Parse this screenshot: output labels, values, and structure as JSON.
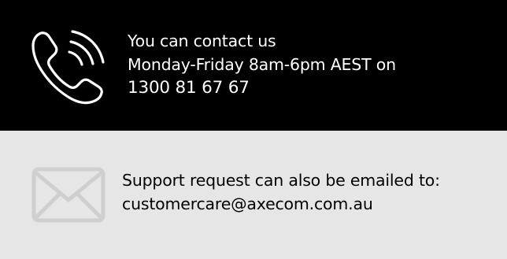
{
  "phone_section": {
    "icon": "phone-call-icon",
    "line1": "You can contact us",
    "line2": "Monday-Friday 8am-6pm AEST on",
    "phone_number": "1300 81 67 67",
    "background": "#000000",
    "text_color": "#ffffff"
  },
  "email_section": {
    "icon": "envelope-icon",
    "line1": "Support request can also be emailed to:",
    "email": "customercare@axecom.com.au",
    "background": "#e6e6e6",
    "text_color": "#000000",
    "icon_color": "#cfcfcf"
  }
}
